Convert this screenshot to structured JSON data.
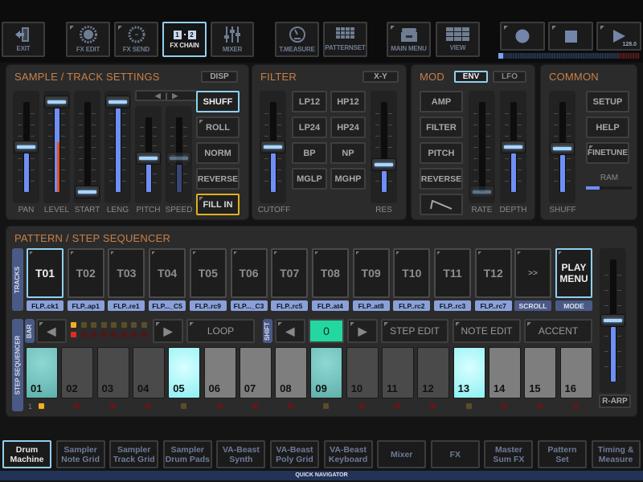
{
  "toolbar": {
    "buttons": [
      {
        "label": "EXIT",
        "icon": "exit-door-icon"
      },
      {
        "label": "FX EDIT",
        "icon": "fx-edit-icon"
      },
      {
        "label": "FX SEND",
        "icon": "fx-send-icon"
      },
      {
        "label": "FX CHAIN",
        "icon": "fx-chain-icon",
        "active": true,
        "icon_text_a": "1",
        "icon_text_b": "2"
      },
      {
        "label": "MIXER",
        "icon": "mixer-sliders-icon"
      },
      {
        "label": "T.MEASURE",
        "icon": "gauge-icon"
      },
      {
        "label": "PATTERNSET",
        "icon": "grid-icon"
      },
      {
        "label": "MAIN MENU",
        "icon": "drawer-icon"
      },
      {
        "label": "VIEW",
        "icon": "view-grid-icon"
      }
    ],
    "transport": {
      "record": "record-icon",
      "stop": "stop-icon",
      "play": "play-icon",
      "tempo": "128.0"
    },
    "song_position_progress": 0.02
  },
  "sample_track": {
    "title": "SAMPLE / TRACK SETTINGS",
    "disp_label": "DISP",
    "arrows_left": "◀",
    "arrows_right": "▶",
    "faders": [
      {
        "label": "PAN",
        "value": 0.5
      },
      {
        "label": "LEVEL",
        "value": 1.0,
        "peak": 0.55
      },
      {
        "label": "START",
        "value": 0.0
      },
      {
        "label": "LENG",
        "value": 1.0
      },
      {
        "label": "PITCH",
        "value": 0.45
      },
      {
        "label": "SPEED",
        "value": 0.45,
        "disabled": true
      }
    ],
    "buttons": [
      {
        "label": "SHUFF",
        "active": true
      },
      {
        "label": "ROLL"
      },
      {
        "label": "NORM"
      },
      {
        "label": "REVERSE"
      },
      {
        "label": "FILL IN",
        "highlight": true
      }
    ]
  },
  "filter": {
    "title": "FILTER",
    "xy_label": "X-Y",
    "types": [
      "LP12",
      "HP12",
      "LP24",
      "HP24",
      "BP",
      "NP",
      "MGLP",
      "MGHP"
    ],
    "faders": [
      {
        "label": "CUTOFF",
        "value": 0.5
      },
      {
        "label": "RES",
        "value": 0.3
      }
    ]
  },
  "mod": {
    "title": "MOD",
    "tabs": [
      {
        "label": "ENV",
        "active": true
      },
      {
        "label": "LFO"
      }
    ],
    "buttons": [
      "AMP",
      "FILTER",
      "PITCH",
      "REVERSE"
    ],
    "shape_icon": "ramp-shape-icon",
    "faders": [
      {
        "label": "RATE",
        "value": 0.0,
        "disabled": true
      },
      {
        "label": "DEPTH",
        "value": 0.5
      }
    ]
  },
  "common": {
    "title": "COMMON",
    "buttons": [
      "SETUP",
      "HELP",
      "FINETUNE"
    ],
    "fader": {
      "label": "SHUFF",
      "value": 0.48
    },
    "ram_label": "RAM",
    "ram_usage": 0.3
  },
  "sequencer": {
    "title": "PATTERN / STEP SEQUENCER",
    "tracks_label": "TRACKS",
    "tracks": [
      {
        "id": "T01",
        "name": "FLP..ck1",
        "active": true
      },
      {
        "id": "T02",
        "name": "FLP..ap1"
      },
      {
        "id": "T03",
        "name": "FLP..re1"
      },
      {
        "id": "T04",
        "name": "FLP..._C5"
      },
      {
        "id": "T05",
        "name": "FLP..rc9"
      },
      {
        "id": "T06",
        "name": "FLP..._C3"
      },
      {
        "id": "T07",
        "name": "FLP..rc5"
      },
      {
        "id": "T08",
        "name": "FLP..at4"
      },
      {
        "id": "T09",
        "name": "FLP..at8"
      },
      {
        "id": "T10",
        "name": "FLP..rc2"
      },
      {
        "id": "T11",
        "name": "FLP..rc3"
      },
      {
        "id": "T12",
        "name": "FLP..rc7"
      }
    ],
    "scroll_label": ">>",
    "scroll_caption": "SCROLL",
    "play_menu_label_1": "PLAY",
    "play_menu_label_2": "MENU",
    "mode_caption": "MODE",
    "step_label": "STEP SEQUENCER",
    "bar_label": "BAR",
    "loop_label": "LOOP",
    "shift_label": "SHIFT",
    "shift_value": "0",
    "step_edit_label": "STEP EDIT",
    "note_edit_label": "NOTE EDIT",
    "accent_label": "ACCENT",
    "bar_number": "1",
    "current_bar": 1,
    "total_bars_visible": 8,
    "steps": [
      {
        "num": "01",
        "state": "on-playing"
      },
      {
        "num": "02",
        "state": "off-dark"
      },
      {
        "num": "03",
        "state": "off-dark"
      },
      {
        "num": "04",
        "state": "off-dark"
      },
      {
        "num": "05",
        "state": "on"
      },
      {
        "num": "06",
        "state": "off-light"
      },
      {
        "num": "07",
        "state": "off-light"
      },
      {
        "num": "08",
        "state": "off-light"
      },
      {
        "num": "09",
        "state": "on-playing"
      },
      {
        "num": "10",
        "state": "off-dark"
      },
      {
        "num": "11",
        "state": "off-dark"
      },
      {
        "num": "12",
        "state": "off-dark"
      },
      {
        "num": "13",
        "state": "on"
      },
      {
        "num": "14",
        "state": "off-light"
      },
      {
        "num": "15",
        "state": "off-light"
      },
      {
        "num": "16",
        "state": "off-light"
      }
    ],
    "r_arp_label": "R-ARP",
    "r_arp_fader": 0.5
  },
  "quick_nav": {
    "title": "QUICK NAVIGATOR",
    "items": [
      {
        "l1": "Drum",
        "l2": "Machine",
        "active": true
      },
      {
        "l1": "Sampler",
        "l2": "Note Grid"
      },
      {
        "l1": "Sampler",
        "l2": "Track Grid"
      },
      {
        "l1": "Sampler",
        "l2": "Drum Pads"
      },
      {
        "l1": "VA-Beast",
        "l2": "Synth"
      },
      {
        "l1": "VA-Beast",
        "l2": "Poly Grid"
      },
      {
        "l1": "VA-Beast",
        "l2": "Keyboard"
      },
      {
        "l1": "Mixer",
        "l2": ""
      },
      {
        "l1": "FX",
        "l2": ""
      },
      {
        "l1": "Master",
        "l2": "Sum FX"
      },
      {
        "l1": "Pattern",
        "l2": "Set"
      },
      {
        "l1": "Timing &",
        "l2": "Measure"
      }
    ]
  },
  "colors": {
    "accent_blue": "#8fd0f0",
    "section_title": "#c88048",
    "fader_fill": "#6f8ff5",
    "step_active": "#aef8fa",
    "step_playing": "#7ccfcc",
    "shift_value_bg": "#22d8a0",
    "fill_in_border": "#e0b020"
  }
}
